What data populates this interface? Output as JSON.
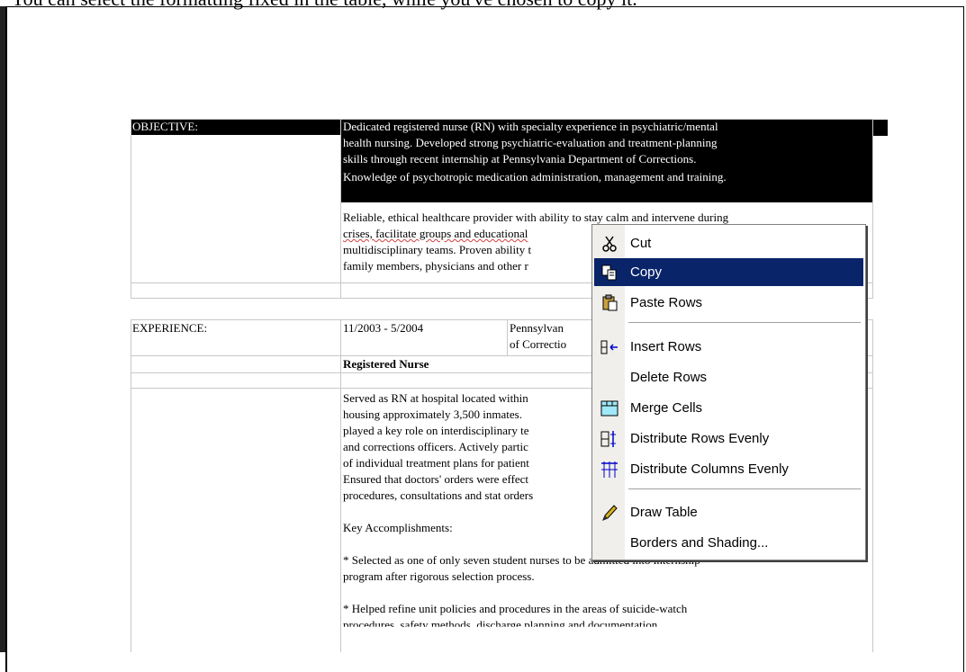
{
  "header_caption": "You can select the formatting fixed in the table, while you've chosen to copy it.",
  "objective": {
    "label": "OBJECTIVE:",
    "lines": [
      "Dedicated registered nurse (RN) with specialty experience in psychiatric/mental",
      "health nursing. Developed strong psychiatric-evaluation and treatment-planning",
      "skills through recent internship at Pennsylvania Department of Corrections.",
      "Knowledge of psychotropic medication administration, management and training."
    ],
    "lines2": [
      "Reliable, ethical healthcare provider with ability to stay calm and intervene during",
      "crises, facilitate groups and educational",
      "multidisciplinary teams. Proven ability t",
      "family members, physicians and other r"
    ]
  },
  "experience": {
    "label": "EXPERIENCE:",
    "dates": "11/2003 - 5/2004",
    "org_line1": "Pennsylvan",
    "org_line2": "of Correctio",
    "title": "Registered Nurse",
    "body_lines": [
      "Served as RN at hospital located within",
      "housing approximately 3,500 inmates.",
      "played a key role on interdisciplinary te",
      "and corrections officers. Actively partic",
      "of individual treatment plans for patient",
      "Ensured that doctors' orders were effect",
      "procedures, consultations and stat orders"
    ],
    "accomplishments_label": "Key Accomplishments:",
    "bullet1_line1": "* Selected as one of only seven student nurses to be admitted into internship",
    "bullet1_line2": "program after rigorous selection process.",
    "bullet2_line1": "* Helped refine unit policies and procedures in the areas of suicide-watch",
    "bullet2_line2": "procedures, safety methods, discharge planning and documentation."
  },
  "context_menu": {
    "items": [
      {
        "label": "Cut",
        "icon": "scissors-icon"
      },
      {
        "label": "Copy",
        "icon": "copy-icon"
      },
      {
        "label": "Paste Rows",
        "icon": "paste-icon"
      },
      {
        "label": "Insert Rows",
        "icon": "insert-rows-icon"
      },
      {
        "label": "Delete Rows",
        "icon": ""
      },
      {
        "label": "Merge Cells",
        "icon": "merge-cells-icon"
      },
      {
        "label": "Distribute Rows Evenly",
        "icon": "distribute-rows-icon"
      },
      {
        "label": "Distribute Columns Evenly",
        "icon": "distribute-columns-icon"
      },
      {
        "label": "Draw Table",
        "icon": "pencil-icon"
      },
      {
        "label": "Borders and Shading...",
        "icon": ""
      }
    ],
    "highlighted": "Copy",
    "highlight_color": "#0a246a"
  }
}
